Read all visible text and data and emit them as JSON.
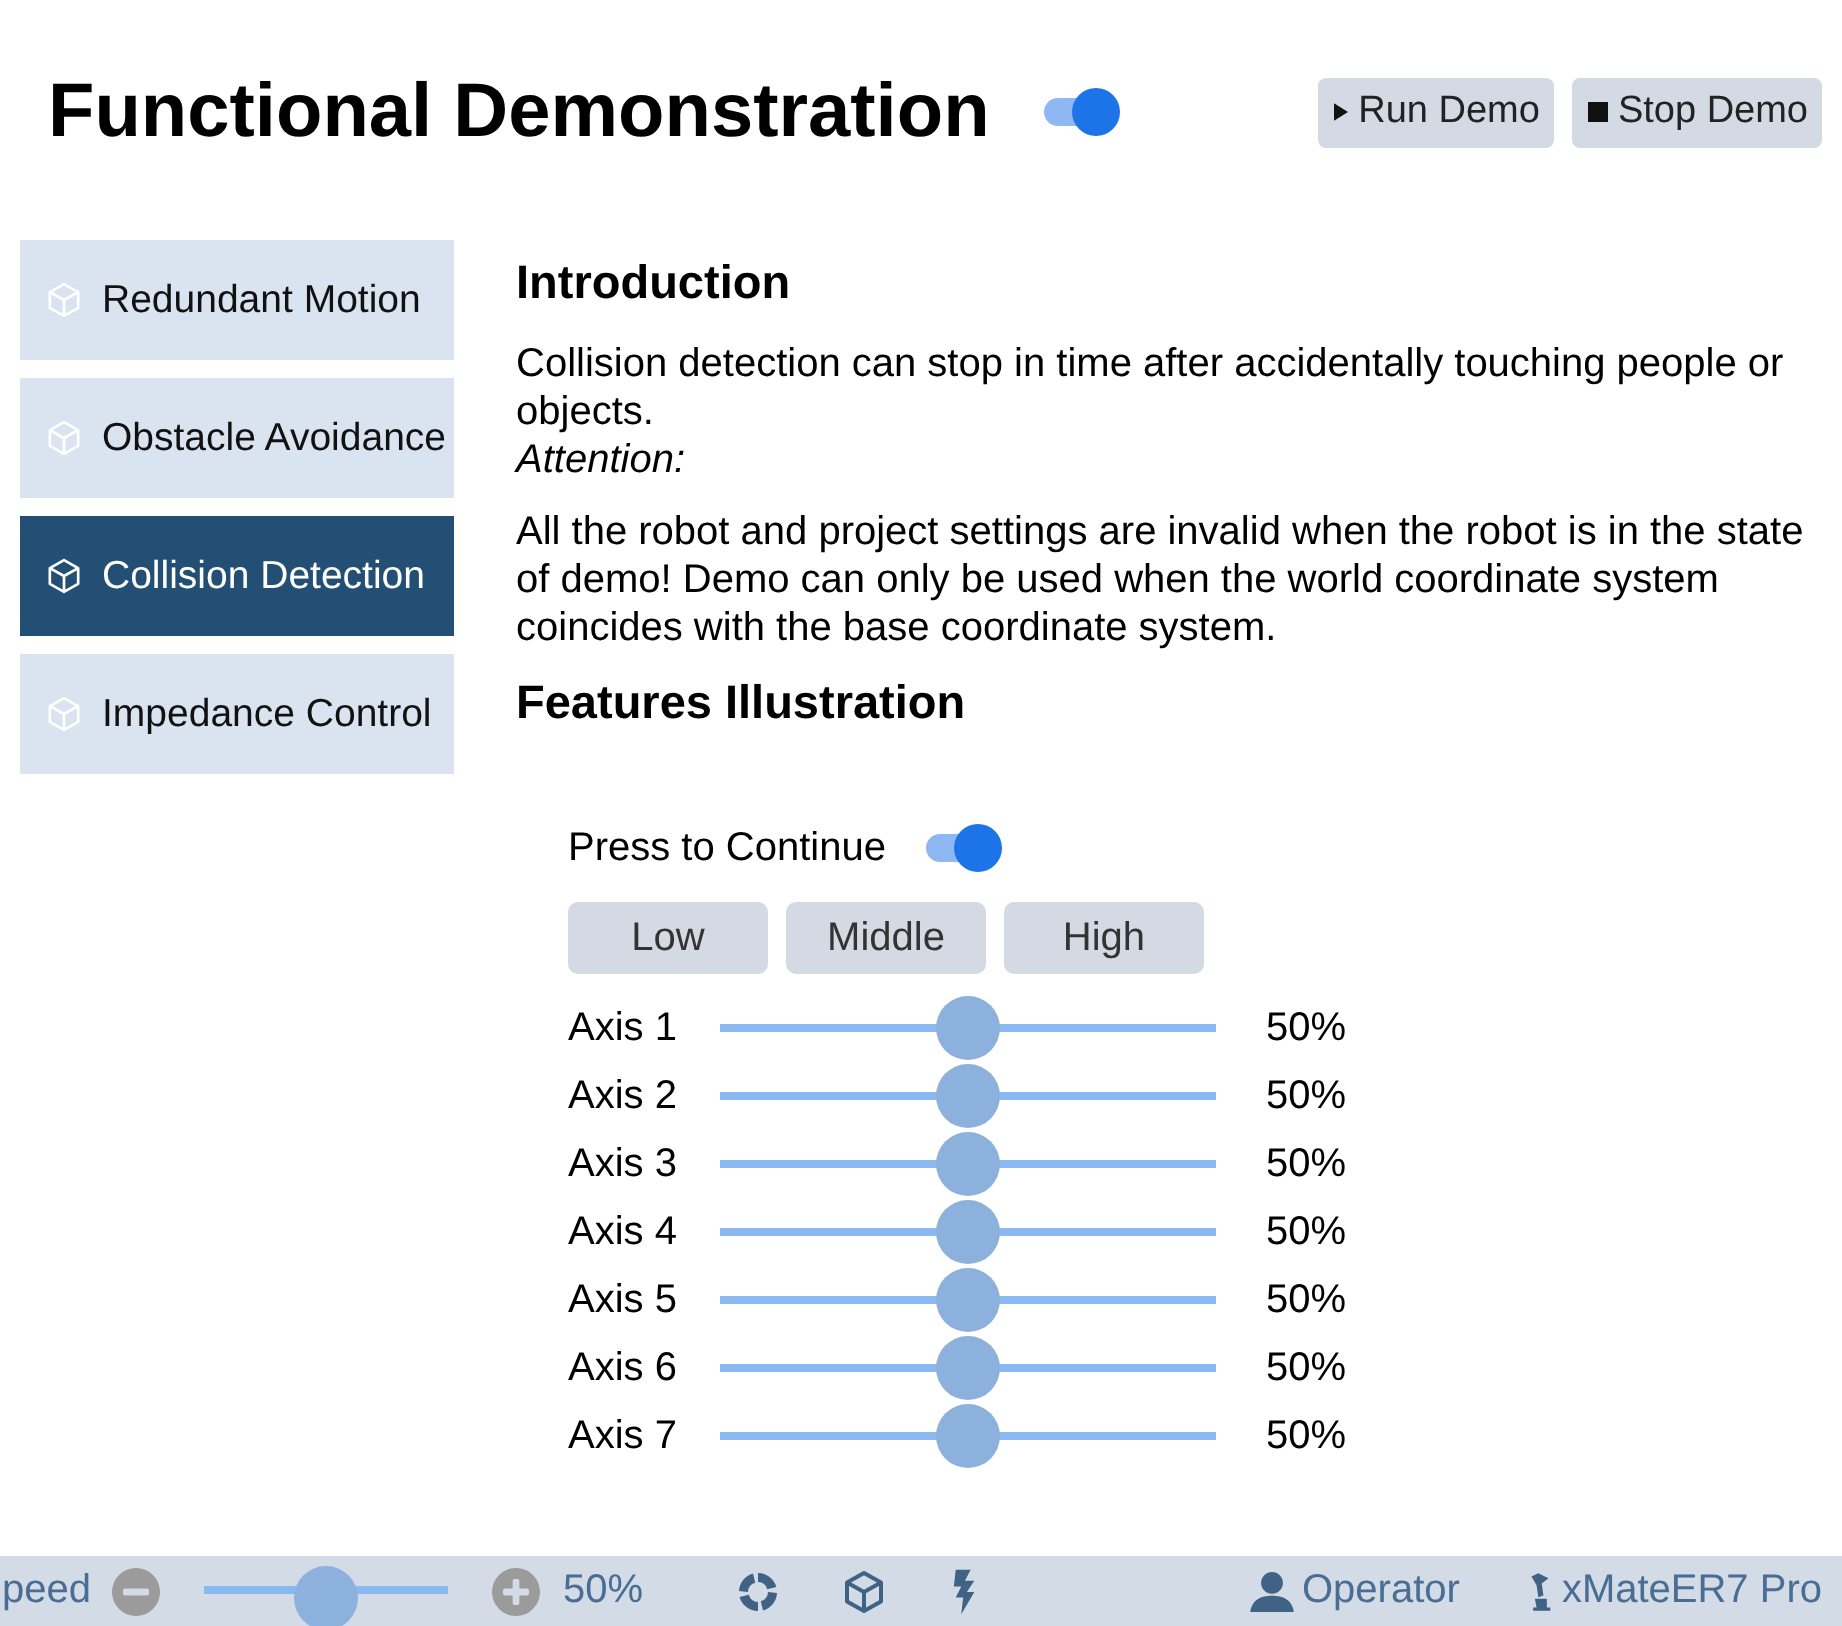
{
  "header": {
    "title": "Functional Demonstration",
    "demo_toggle": {
      "on": true
    },
    "buttons": [
      {
        "label": "Run Demo",
        "kind": "run"
      },
      {
        "label": "Stop Demo",
        "kind": "stop"
      }
    ]
  },
  "sidebar": {
    "items": [
      {
        "label": "Redundant Motion",
        "selected": false
      },
      {
        "label": "Obstacle Avoidance",
        "selected": false
      },
      {
        "label": "Collision Detection",
        "selected": true
      },
      {
        "label": "Impedance Control",
        "selected": false
      }
    ]
  },
  "introduction": {
    "heading": "Introduction",
    "text": "Collision detection can stop in time after accidentally touching people or objects.",
    "attention_label": "Attention:",
    "attention_text": "All the robot and project settings are invalid when the robot is in the state of demo! Demo can only be used when the world coordinate system coincides with the base coordinate system."
  },
  "features": {
    "heading": "Features Illustration",
    "continue_toggle": {
      "label": "Press to Continue",
      "on": true
    },
    "presets": [
      {
        "label": "Low",
        "selected": false
      },
      {
        "label": "Middle",
        "selected": false
      },
      {
        "label": "High",
        "selected": false
      }
    ],
    "axes": [
      {
        "label": "Axis 1",
        "level": 0.5,
        "reading": "50%"
      },
      {
        "label": "Axis 2",
        "level": 0.5,
        "reading": "50%"
      },
      {
        "label": "Axis 3",
        "level": 0.5,
        "reading": "50%"
      },
      {
        "label": "Axis 4",
        "level": 0.5,
        "reading": "50%"
      },
      {
        "label": "Axis 5",
        "level": 0.5,
        "reading": "50%"
      },
      {
        "label": "Axis 6",
        "level": 0.5,
        "reading": "50%"
      },
      {
        "label": "Axis 7",
        "level": 0.5,
        "reading": "50%"
      }
    ]
  },
  "status_bar": {
    "speed": {
      "label": "peed",
      "level": 0.5,
      "reading": "50%"
    },
    "user": "Operator",
    "robot": "xMateER7 Pro"
  }
}
